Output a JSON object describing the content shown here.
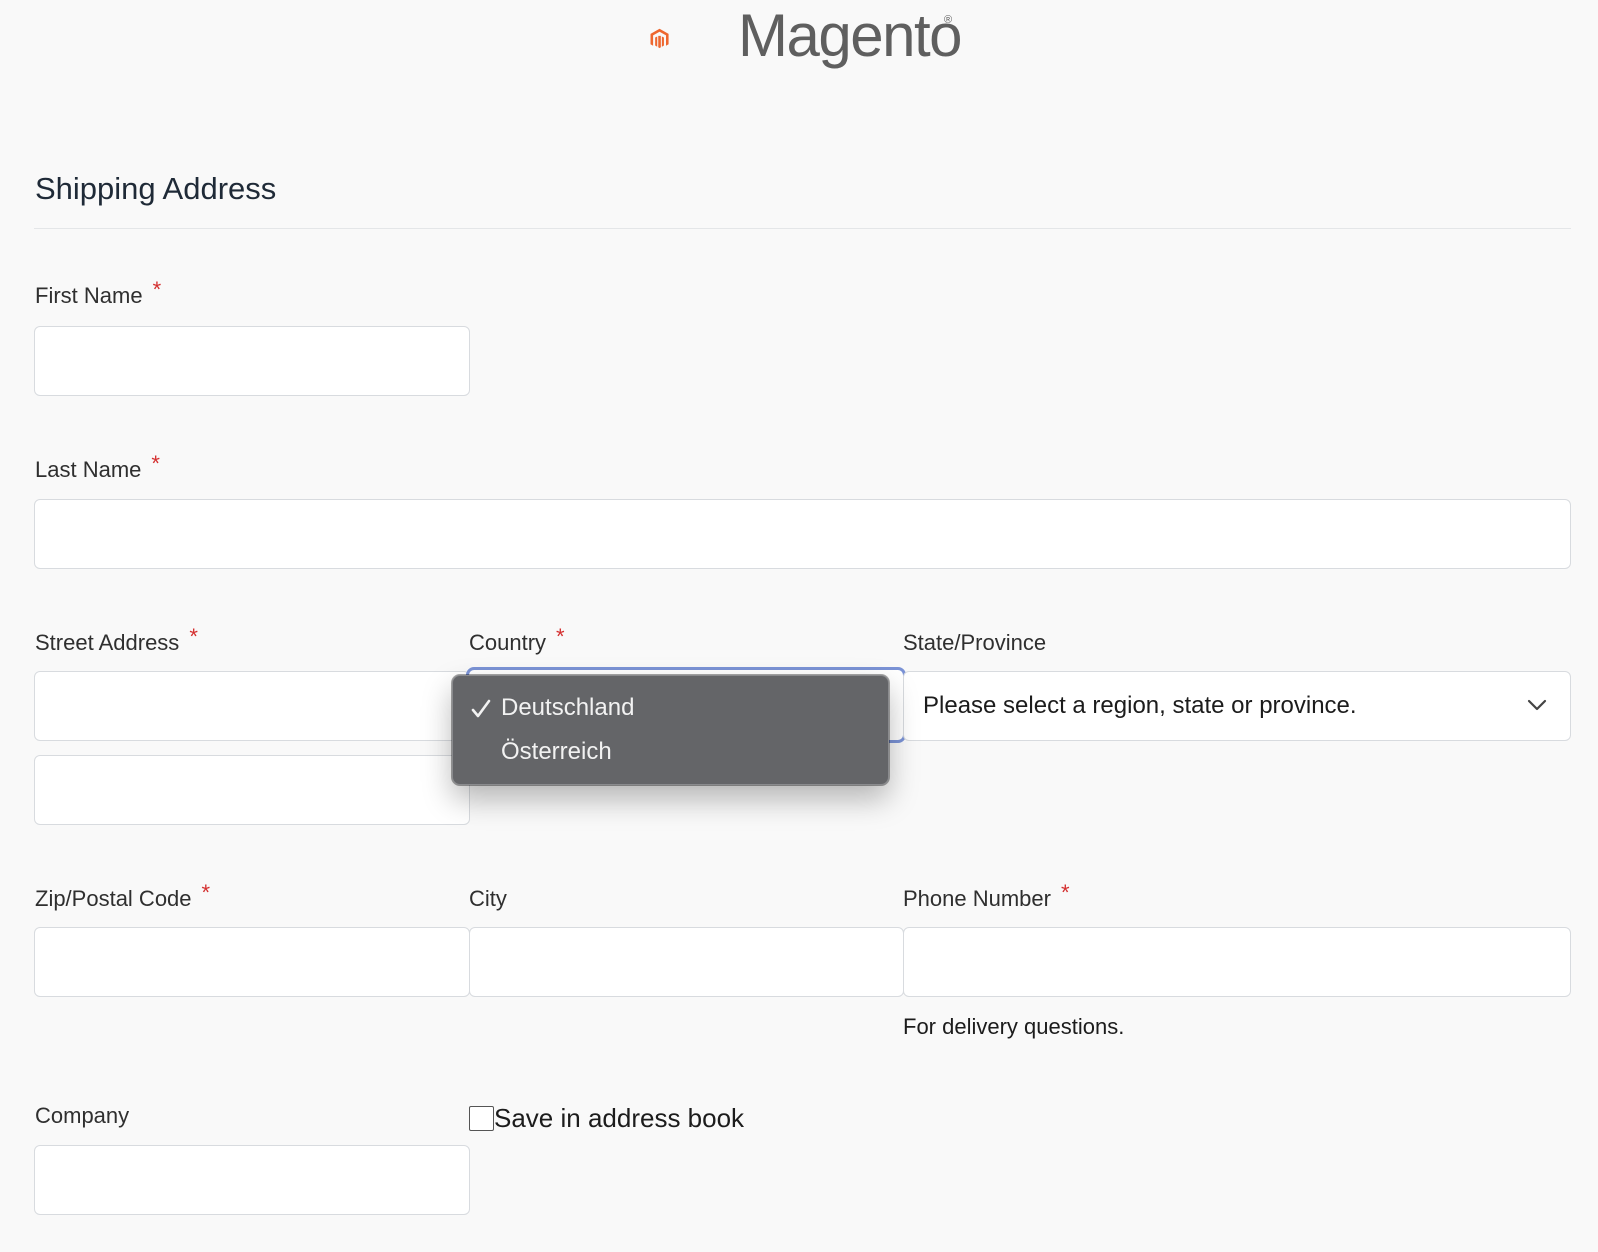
{
  "logo": {
    "text": "Magento",
    "reg": "®",
    "icon": "magento-logo-icon",
    "color": "#ee672f"
  },
  "heading": "Shipping Address",
  "fields": {
    "first_name": {
      "label": "First Name",
      "required": "*",
      "value": ""
    },
    "last_name": {
      "label": "Last Name",
      "required": "*",
      "value": ""
    },
    "street": {
      "label": "Street Address",
      "required": "*",
      "line1": "",
      "line2": ""
    },
    "country": {
      "label": "Country",
      "required": "*",
      "options": [
        "Deutschland",
        "Österreich"
      ],
      "selected": "Deutschland"
    },
    "state": {
      "label": "State/Province",
      "value": "Please select a region, state or province."
    },
    "zip": {
      "label": "Zip/Postal Code",
      "required": "*",
      "value": ""
    },
    "city": {
      "label": "City",
      "value": ""
    },
    "phone": {
      "label": "Phone Number",
      "required": "*",
      "value": "",
      "help": "For delivery questions."
    },
    "company": {
      "label": "Company",
      "value": ""
    },
    "save_address": {
      "label": "Save in address book",
      "checked": false
    }
  },
  "colors": {
    "required": "#d42f2f",
    "focus": "#7b93d6",
    "menu_bg": "#646568"
  }
}
